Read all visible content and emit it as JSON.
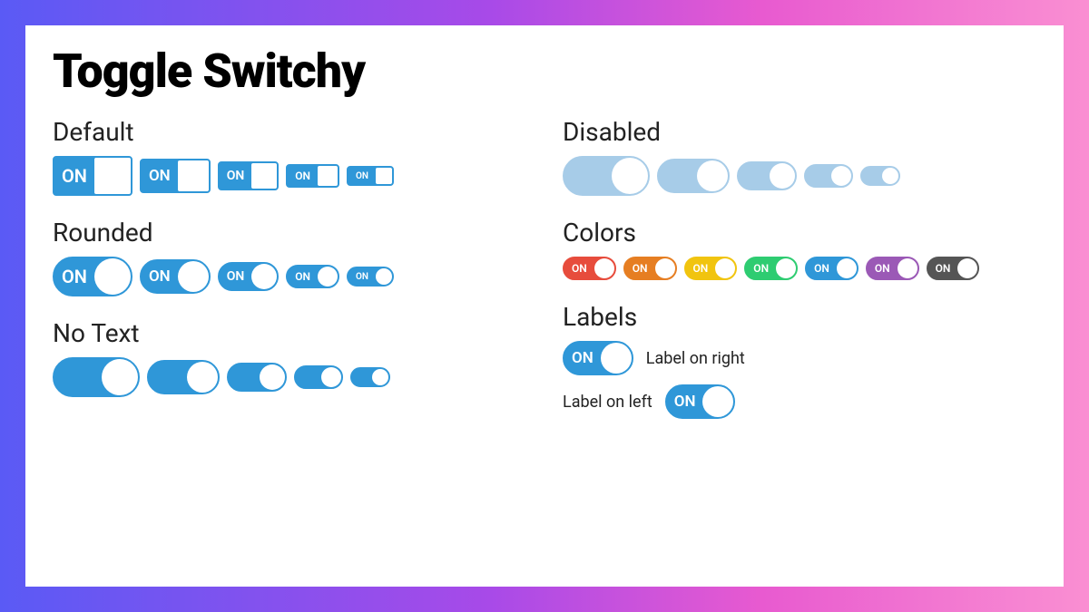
{
  "title": "Toggle Switchy",
  "sections": {
    "default": {
      "label": "Default"
    },
    "rounded": {
      "label": "Rounded"
    },
    "notext": {
      "label": "No Text"
    },
    "disabled": {
      "label": "Disabled"
    },
    "colors": {
      "label": "Colors"
    },
    "labels": {
      "label": "Labels"
    }
  },
  "on_text": "ON",
  "colors": {
    "red": "#e74c3c",
    "orange": "#e67e22",
    "yellow": "#f1c40f",
    "green": "#2ecc71",
    "blue": "#2f97d8",
    "purple": "#9b59b6",
    "gray": "#555555"
  },
  "labels": {
    "right": "Label on right",
    "left": "Label on left"
  }
}
